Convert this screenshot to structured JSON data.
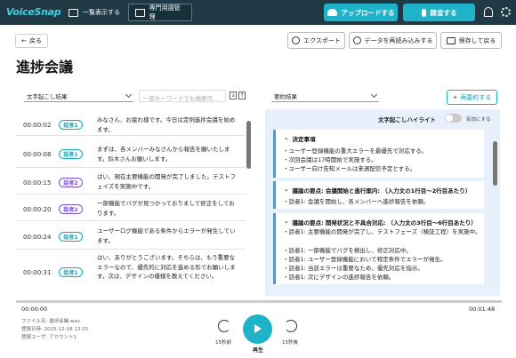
{
  "header": {
    "logo": "VoiceSnap",
    "nav": [
      "一覧表示する",
      "専門用語管理"
    ],
    "upload_label": "アップロードする",
    "record_label": "録音する",
    "icons": [
      "bell-icon",
      "gear-icon"
    ],
    "accent": "#1fb3c9",
    "bg": "#1f3a44"
  },
  "toolbar": {
    "back": "戻る",
    "export": "エクスポート",
    "reload": "データを再読み込みする",
    "save_back": "保存して戻る"
  },
  "page": {
    "title": "進捗会議"
  },
  "left": {
    "select_value": "文字起こし結果",
    "search_placeholder": "一部キーワードでも検索可...",
    "rows": [
      {
        "time": "00:00:02",
        "speaker": "話者1",
        "text": "みなさん、お疲れ様です。今日は定例進捗会議を始めます。"
      },
      {
        "time": "00:00:08",
        "speaker": "話者1",
        "text": "まずは、各メンバーみなさんから報告を願いたします。鈴木さんお願いします。"
      },
      {
        "time": "00:00:15",
        "speaker": "話者2",
        "text": "はい、現在主要機能の開発が完了しました。テストフェイズを実施中です。"
      },
      {
        "time": "00:00:20",
        "speaker": "話者2",
        "text": "一部機能でバグが見つかっておりまして修正をしております。"
      },
      {
        "time": "00:00:24",
        "speaker": "話者1",
        "text": "ユーザーログ機能である条件からエラーが発生しています。"
      },
      {
        "time": "00:00:31",
        "speaker": "話者1",
        "text": "はい、ありがとうございます。そちらは、もう重要なエラーなので、優先的に対応を進める形でお願いします。次は、デザインの優様を教えてください。"
      }
    ]
  },
  "right": {
    "select_value": "要約結果",
    "resummarize": "再要約する",
    "highlight_label": "文字起こしハイライト",
    "highlight_state": "有効にする",
    "cards": [
      {
        "title": "決定事項",
        "lines": [
          "・ユーザー登録機能の重大エラーを最優先で対応する。",
          "・次回会議は17時開始で実施する。",
          "・ユーザー向け告知メールは来週配信予定とする。"
        ]
      },
      {
        "title": "議論の要点: 会議開始と進行案内: （入力文の1行目〜2行目あたり）",
        "lines": [
          "・話者1: 会議を開始し、各メンバーへ進捗報告を依頼。"
        ]
      },
      {
        "title": "議論の要点: 開発状況と不具合対応: （入力文の3行目〜6行目あたり）",
        "lines": [
          "・話者1: 主要機能の開発が完了し、テストフェーズ（検証工程）を実施中。",
          "・話者1: 一部機能でバグを検出し、修正対応中。",
          "・話者1: ユーザー登録機能において特定条件でエラーが発生。",
          "・話者1: 当該エラーは重要なため、優先対応を指示。",
          "・話者1: 次にデザインの進捗報告を依頼。"
        ]
      }
    ]
  },
  "player": {
    "current": "00:00:00",
    "total": "00:01:48",
    "progress": 0,
    "file": "ファイル名: 進捗会議.wav",
    "date": "登録日時: 2025-12-18 13:15",
    "user": "登録ユーザ: アカウント1",
    "back15": "15秒前",
    "play": "再生",
    "fwd15": "15秒後"
  }
}
